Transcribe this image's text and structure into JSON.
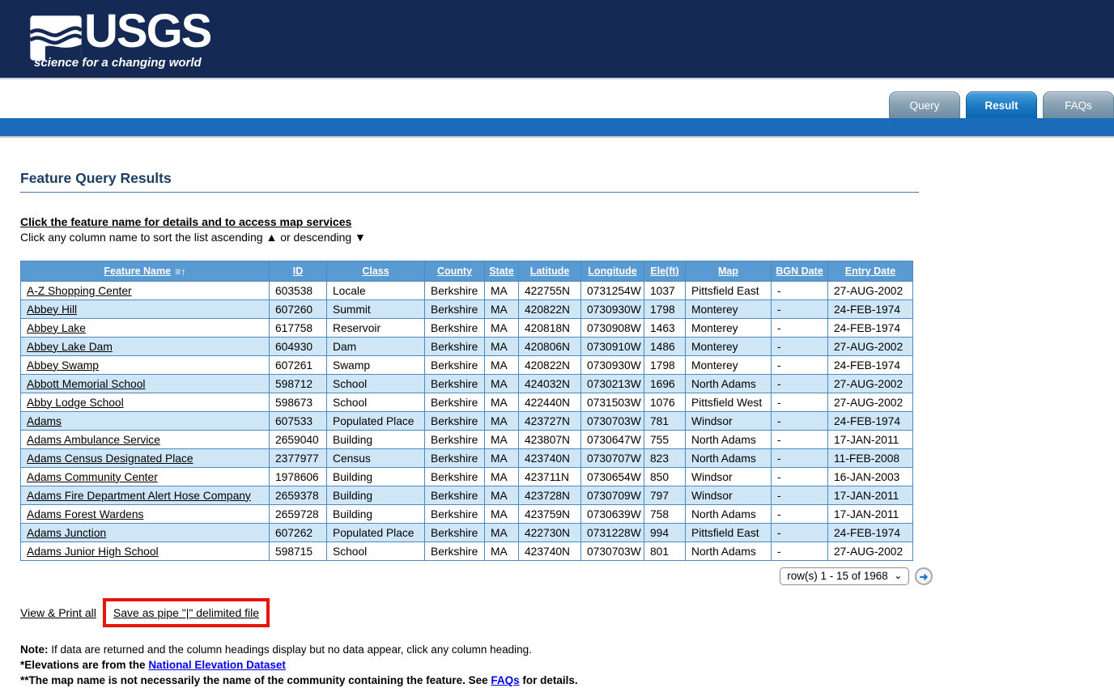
{
  "header": {
    "brand": "USGS",
    "tagline": "science for a changing world"
  },
  "tabs": [
    {
      "label": "Query",
      "active": false
    },
    {
      "label": "Result",
      "active": true
    },
    {
      "label": "FAQs",
      "active": false
    }
  ],
  "page": {
    "title": "Feature Query Results",
    "instruction_main": "Click the feature name for details and to access map services",
    "instruction_sub": "Click any column name to sort the list ascending ▲ or descending ▼"
  },
  "table": {
    "columns": [
      "Feature Name",
      "ID",
      "Class",
      "County",
      "State",
      "Latitude",
      "Longitude",
      "Ele(ft)",
      "Map",
      "BGN Date",
      "Entry Date"
    ],
    "sorted_column": "Feature Name",
    "rows": [
      [
        "A-Z Shopping Center",
        "603538",
        "Locale",
        "Berkshire",
        "MA",
        "422755N",
        "0731254W",
        "1037",
        "Pittsfield East",
        "-",
        "27-AUG-2002"
      ],
      [
        "Abbey Hill",
        "607260",
        "Summit",
        "Berkshire",
        "MA",
        "420822N",
        "0730930W",
        "1798",
        "Monterey",
        "-",
        "24-FEB-1974"
      ],
      [
        "Abbey Lake",
        "617758",
        "Reservoir",
        "Berkshire",
        "MA",
        "420818N",
        "0730908W",
        "1463",
        "Monterey",
        "-",
        "24-FEB-1974"
      ],
      [
        "Abbey Lake Dam",
        "604930",
        "Dam",
        "Berkshire",
        "MA",
        "420806N",
        "0730910W",
        "1486",
        "Monterey",
        "-",
        "27-AUG-2002"
      ],
      [
        "Abbey Swamp",
        "607261",
        "Swamp",
        "Berkshire",
        "MA",
        "420822N",
        "0730930W",
        "1798",
        "Monterey",
        "-",
        "24-FEB-1974"
      ],
      [
        "Abbott Memorial School",
        "598712",
        "School",
        "Berkshire",
        "MA",
        "424032N",
        "0730213W",
        "1696",
        "North Adams",
        "-",
        "27-AUG-2002"
      ],
      [
        "Abby Lodge School",
        "598673",
        "School",
        "Berkshire",
        "MA",
        "422440N",
        "0731503W",
        "1076",
        "Pittsfield West",
        "-",
        "27-AUG-2002"
      ],
      [
        "Adams",
        "607533",
        "Populated Place",
        "Berkshire",
        "MA",
        "423727N",
        "0730703W",
        "781",
        "Windsor",
        "-",
        "24-FEB-1974"
      ],
      [
        "Adams Ambulance Service",
        "2659040",
        "Building",
        "Berkshire",
        "MA",
        "423807N",
        "0730647W",
        "755",
        "North Adams",
        "-",
        "17-JAN-2011"
      ],
      [
        "Adams Census Designated Place",
        "2377977",
        "Census",
        "Berkshire",
        "MA",
        "423740N",
        "0730707W",
        "823",
        "North Adams",
        "-",
        "11-FEB-2008"
      ],
      [
        "Adams Community Center",
        "1978606",
        "Building",
        "Berkshire",
        "MA",
        "423711N",
        "0730654W",
        "850",
        "Windsor",
        "-",
        "16-JAN-2003"
      ],
      [
        "Adams Fire Department Alert Hose Company",
        "2659378",
        "Building",
        "Berkshire",
        "MA",
        "423728N",
        "0730709W",
        "797",
        "Windsor",
        "-",
        "17-JAN-2011"
      ],
      [
        "Adams Forest Wardens",
        "2659728",
        "Building",
        "Berkshire",
        "MA",
        "423759N",
        "0730639W",
        "758",
        "North Adams",
        "-",
        "17-JAN-2011"
      ],
      [
        "Adams Junction",
        "607262",
        "Populated Place",
        "Berkshire",
        "MA",
        "422730N",
        "0731228W",
        "994",
        "Pittsfield East",
        "-",
        "24-FEB-1974"
      ],
      [
        "Adams Junior High School",
        "598715",
        "School",
        "Berkshire",
        "MA",
        "423740N",
        "0730703W",
        "801",
        "North Adams",
        "-",
        "27-AUG-2002"
      ]
    ]
  },
  "pagination": {
    "selected_option": "row(s) 1 - 15 of 1968"
  },
  "actions": {
    "view_print_label": "View & Print all",
    "save_pipe_label": "Save as pipe \"|\" delimited file"
  },
  "notes": {
    "note_label": "Note:",
    "note_text": " If data are returned and the column headings display but no data appear, click any column heading.",
    "elevation_prefix": "*Elevations are from the ",
    "elevation_link": "National Elevation Dataset",
    "map_prefix": "**The map name is not necessarily the name of the community containing the feature. See ",
    "map_link": "FAQs",
    "map_suffix": " for details."
  },
  "icons": {
    "sort_ascending": "≡↑",
    "dropdown_chevron": "⌄",
    "go_arrow": "➜"
  },
  "colors": {
    "banner_navy": "#142a54",
    "blue_bar": "#1a6cba",
    "active_tab": "#1a77c2",
    "inactive_tab": "#8aa2b4",
    "table_header_bg": "#5a9ad2",
    "table_border": "#4d89bd",
    "alt_row_bg": "#cfe6f7",
    "annotation_red": "#e8150d",
    "note_link_blue": "#0000ee",
    "title_navy": "#1c3e63"
  }
}
